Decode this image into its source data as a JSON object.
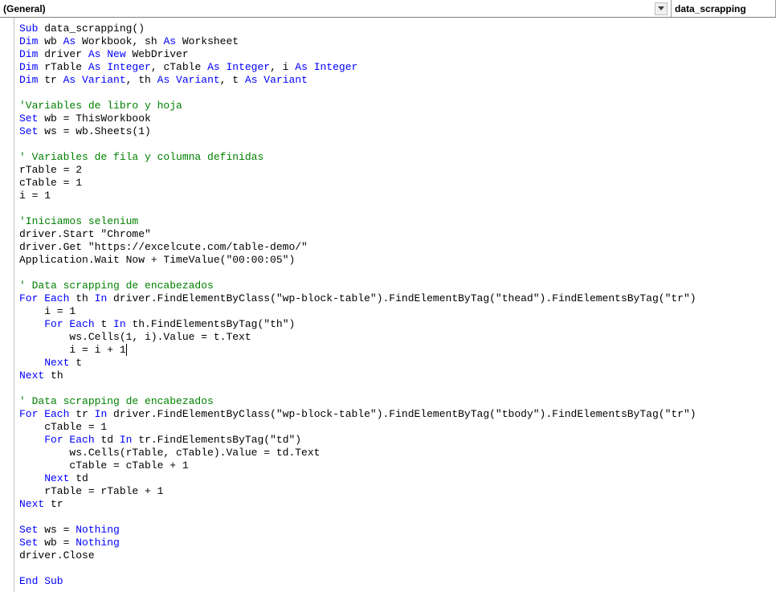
{
  "dropdowns": {
    "left": "(General)",
    "right": "data_scrapping"
  },
  "code": {
    "lines": [
      [
        {
          "t": "kw",
          "v": "Sub"
        },
        {
          "t": "txt",
          "v": " data_scrapping()"
        }
      ],
      [
        {
          "t": "kw",
          "v": "Dim"
        },
        {
          "t": "txt",
          "v": " wb "
        },
        {
          "t": "kw",
          "v": "As"
        },
        {
          "t": "txt",
          "v": " Workbook, sh "
        },
        {
          "t": "kw",
          "v": "As"
        },
        {
          "t": "txt",
          "v": " Worksheet"
        }
      ],
      [
        {
          "t": "kw",
          "v": "Dim"
        },
        {
          "t": "txt",
          "v": " driver "
        },
        {
          "t": "kw",
          "v": "As New"
        },
        {
          "t": "txt",
          "v": " WebDriver"
        }
      ],
      [
        {
          "t": "kw",
          "v": "Dim"
        },
        {
          "t": "txt",
          "v": " rTable "
        },
        {
          "t": "kw",
          "v": "As Integer"
        },
        {
          "t": "txt",
          "v": ", cTable "
        },
        {
          "t": "kw",
          "v": "As Integer"
        },
        {
          "t": "txt",
          "v": ", i "
        },
        {
          "t": "kw",
          "v": "As Integer"
        }
      ],
      [
        {
          "t": "kw",
          "v": "Dim"
        },
        {
          "t": "txt",
          "v": " tr "
        },
        {
          "t": "kw",
          "v": "As Variant"
        },
        {
          "t": "txt",
          "v": ", th "
        },
        {
          "t": "kw",
          "v": "As Variant"
        },
        {
          "t": "txt",
          "v": ", t "
        },
        {
          "t": "kw",
          "v": "As Variant"
        }
      ],
      [],
      [
        {
          "t": "cm",
          "v": "'Variables de libro y hoja"
        }
      ],
      [
        {
          "t": "kw",
          "v": "Set"
        },
        {
          "t": "txt",
          "v": " wb = ThisWorkbook"
        }
      ],
      [
        {
          "t": "kw",
          "v": "Set"
        },
        {
          "t": "txt",
          "v": " ws = wb.Sheets(1)"
        }
      ],
      [],
      [
        {
          "t": "cm",
          "v": "' Variables de fila y columna definidas"
        }
      ],
      [
        {
          "t": "txt",
          "v": "rTable = 2"
        }
      ],
      [
        {
          "t": "txt",
          "v": "cTable = 1"
        }
      ],
      [
        {
          "t": "txt",
          "v": "i = 1"
        }
      ],
      [],
      [
        {
          "t": "cm",
          "v": "'Iniciamos selenium"
        }
      ],
      [
        {
          "t": "txt",
          "v": "driver.Start \"Chrome\""
        }
      ],
      [
        {
          "t": "txt",
          "v": "driver.Get \"https://excelcute.com/table-demo/\""
        }
      ],
      [
        {
          "t": "txt",
          "v": "Application.Wait Now + TimeValue(\"00:00:05\")"
        }
      ],
      [],
      [
        {
          "t": "cm",
          "v": "' Data scrapping de encabezados"
        }
      ],
      [
        {
          "t": "kw",
          "v": "For Each"
        },
        {
          "t": "txt",
          "v": " th "
        },
        {
          "t": "kw",
          "v": "In"
        },
        {
          "t": "txt",
          "v": " driver.FindElementByClass(\"wp-block-table\").FindElementByTag(\"thead\").FindElementsByTag(\"tr\")"
        }
      ],
      [
        {
          "t": "txt",
          "v": "    i = 1"
        }
      ],
      [
        {
          "t": "txt",
          "v": "    "
        },
        {
          "t": "kw",
          "v": "For Each"
        },
        {
          "t": "txt",
          "v": " t "
        },
        {
          "t": "kw",
          "v": "In"
        },
        {
          "t": "txt",
          "v": " th.FindElementsByTag(\"th\")"
        }
      ],
      [
        {
          "t": "txt",
          "v": "        ws.Cells(1, i).Value = t.Text"
        }
      ],
      [
        {
          "t": "txt",
          "v": "        i = i + 1"
        },
        {
          "t": "cursor",
          "v": ""
        }
      ],
      [
        {
          "t": "txt",
          "v": "    "
        },
        {
          "t": "kw",
          "v": "Next"
        },
        {
          "t": "txt",
          "v": " t"
        }
      ],
      [
        {
          "t": "kw",
          "v": "Next"
        },
        {
          "t": "txt",
          "v": " th"
        }
      ],
      [],
      [
        {
          "t": "cm",
          "v": "' Data scrapping de encabezados"
        }
      ],
      [
        {
          "t": "kw",
          "v": "For Each"
        },
        {
          "t": "txt",
          "v": " tr "
        },
        {
          "t": "kw",
          "v": "In"
        },
        {
          "t": "txt",
          "v": " driver.FindElementByClass(\"wp-block-table\").FindElementByTag(\"tbody\").FindElementsByTag(\"tr\")"
        }
      ],
      [
        {
          "t": "txt",
          "v": "    cTable = 1"
        }
      ],
      [
        {
          "t": "txt",
          "v": "    "
        },
        {
          "t": "kw",
          "v": "For Each"
        },
        {
          "t": "txt",
          "v": " td "
        },
        {
          "t": "kw",
          "v": "In"
        },
        {
          "t": "txt",
          "v": " tr.FindElementsByTag(\"td\")"
        }
      ],
      [
        {
          "t": "txt",
          "v": "        ws.Cells(rTable, cTable).Value = td.Text"
        }
      ],
      [
        {
          "t": "txt",
          "v": "        cTable = cTable + 1"
        }
      ],
      [
        {
          "t": "txt",
          "v": "    "
        },
        {
          "t": "kw",
          "v": "Next"
        },
        {
          "t": "txt",
          "v": " td"
        }
      ],
      [
        {
          "t": "txt",
          "v": "    rTable = rTable + 1"
        }
      ],
      [
        {
          "t": "kw",
          "v": "Next"
        },
        {
          "t": "txt",
          "v": " tr"
        }
      ],
      [],
      [
        {
          "t": "kw",
          "v": "Set"
        },
        {
          "t": "txt",
          "v": " ws = "
        },
        {
          "t": "kw",
          "v": "Nothing"
        }
      ],
      [
        {
          "t": "kw",
          "v": "Set"
        },
        {
          "t": "txt",
          "v": " wb = "
        },
        {
          "t": "kw",
          "v": "Nothing"
        }
      ],
      [
        {
          "t": "txt",
          "v": "driver.Close"
        }
      ],
      [],
      [
        {
          "t": "kw",
          "v": "End Sub"
        }
      ]
    ]
  }
}
